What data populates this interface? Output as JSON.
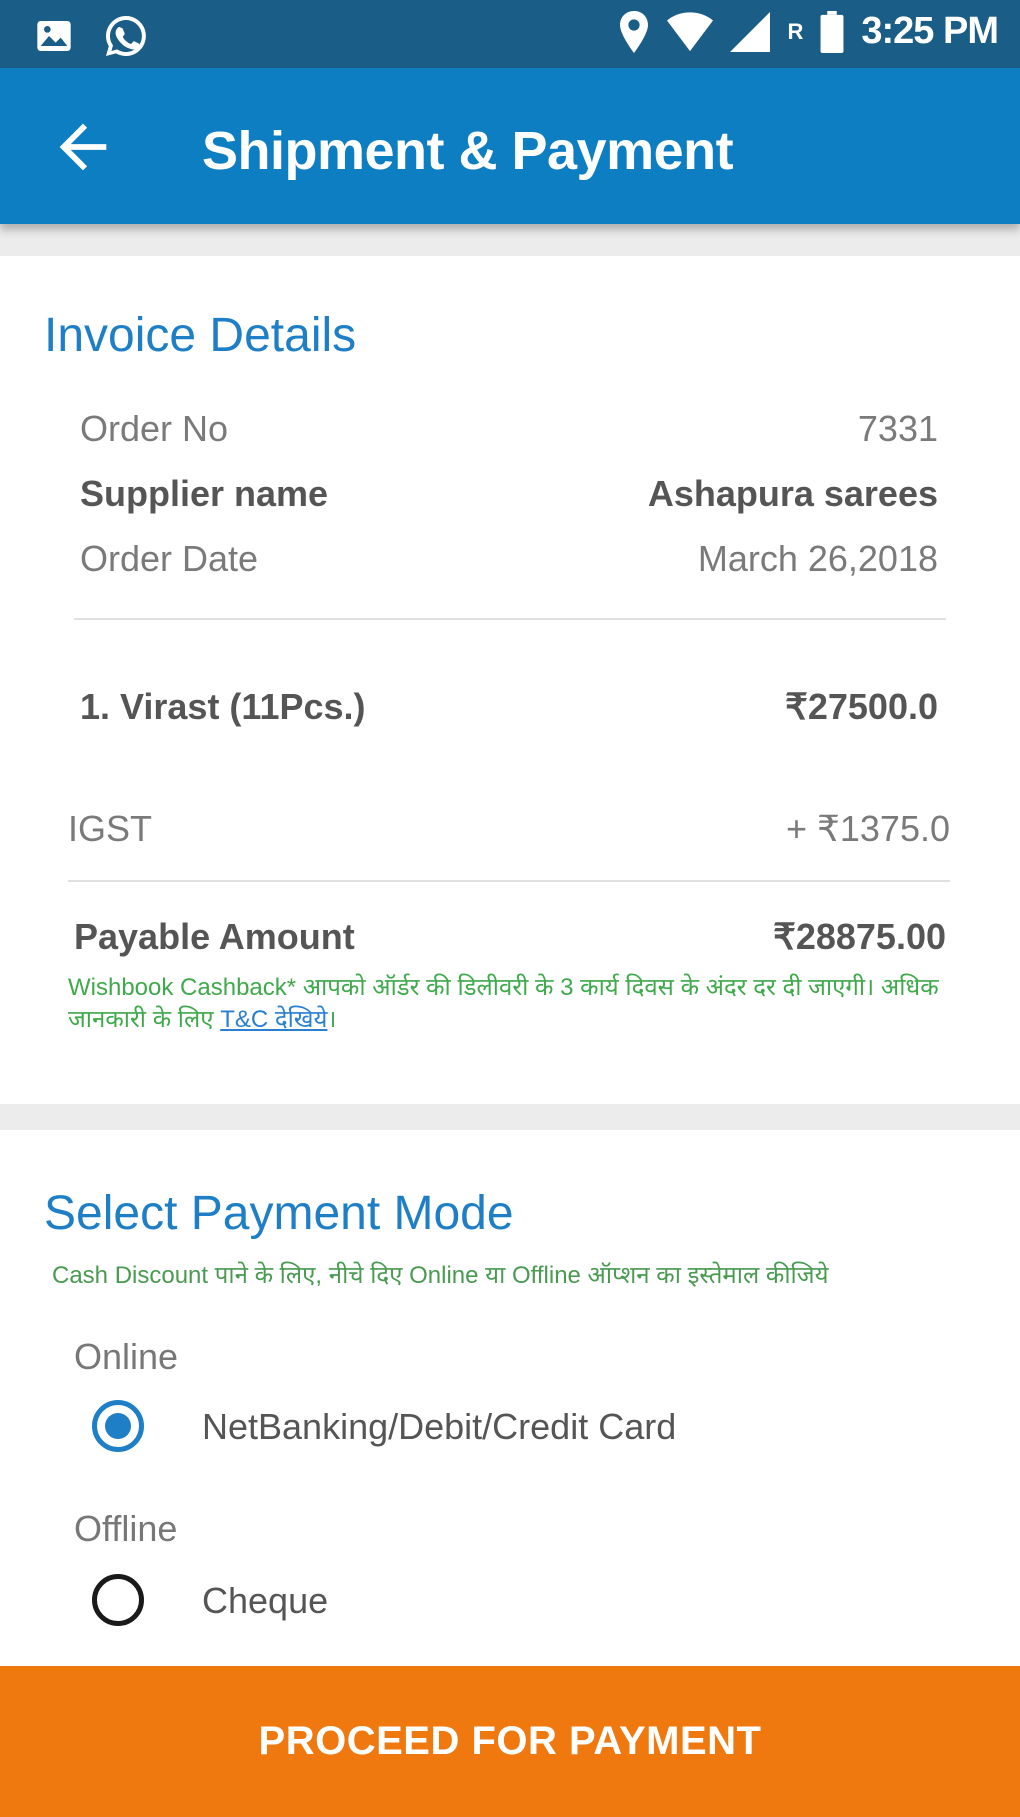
{
  "status_bar": {
    "time": "3:25 PM",
    "carrier_badge": "R",
    "icons_left": [
      "image-icon",
      "whatsapp-icon"
    ],
    "icons_right": [
      "location-icon",
      "wifi-icon",
      "signal-icon",
      "battery-icon"
    ]
  },
  "app_bar": {
    "title": "Shipment & Payment",
    "back_icon": "arrow-left-icon"
  },
  "invoice": {
    "title": "Invoice Details",
    "order_no_label": "Order No",
    "order_no_value": "7331",
    "supplier_label": "Supplier name",
    "supplier_value": "Ashapura sarees",
    "order_date_label": "Order Date",
    "order_date_value": "March 26,2018",
    "item_label": "1. Virast (11Pcs.)",
    "item_value": "₹27500.0",
    "igst_label": "IGST",
    "igst_value": "+ ₹1375.0",
    "payable_label": "Payable Amount",
    "payable_value": "₹28875.00",
    "cashback_note": "Wishbook Cashback* आपको ऑर्डर की डिलीवरी के 3 कार्य दिवस के अंदर दर दी जाएगी। अधिक जानकारी के लिए",
    "cashback_link": "T&C देखिये",
    "cashback_end": "।"
  },
  "payment": {
    "title": "Select Payment Mode",
    "note": "Cash Discount पाने के लिए, नीचे दिए Online या Offline ऑप्शन का इस्तेमाल कीजिये",
    "online_header": "Online",
    "online_option": "NetBanking/Debit/Credit Card",
    "offline_header": "Offline",
    "offline_option": "Cheque",
    "selected": "online"
  },
  "cta_label": "PROCEED FOR PAYMENT",
  "colors": {
    "status_bar": "#1a5d86",
    "app_bar": "#0e7ec2",
    "accent_blue": "#1e7fc6",
    "note_green": "#3fa94c",
    "cta_orange": "#f0790f"
  }
}
